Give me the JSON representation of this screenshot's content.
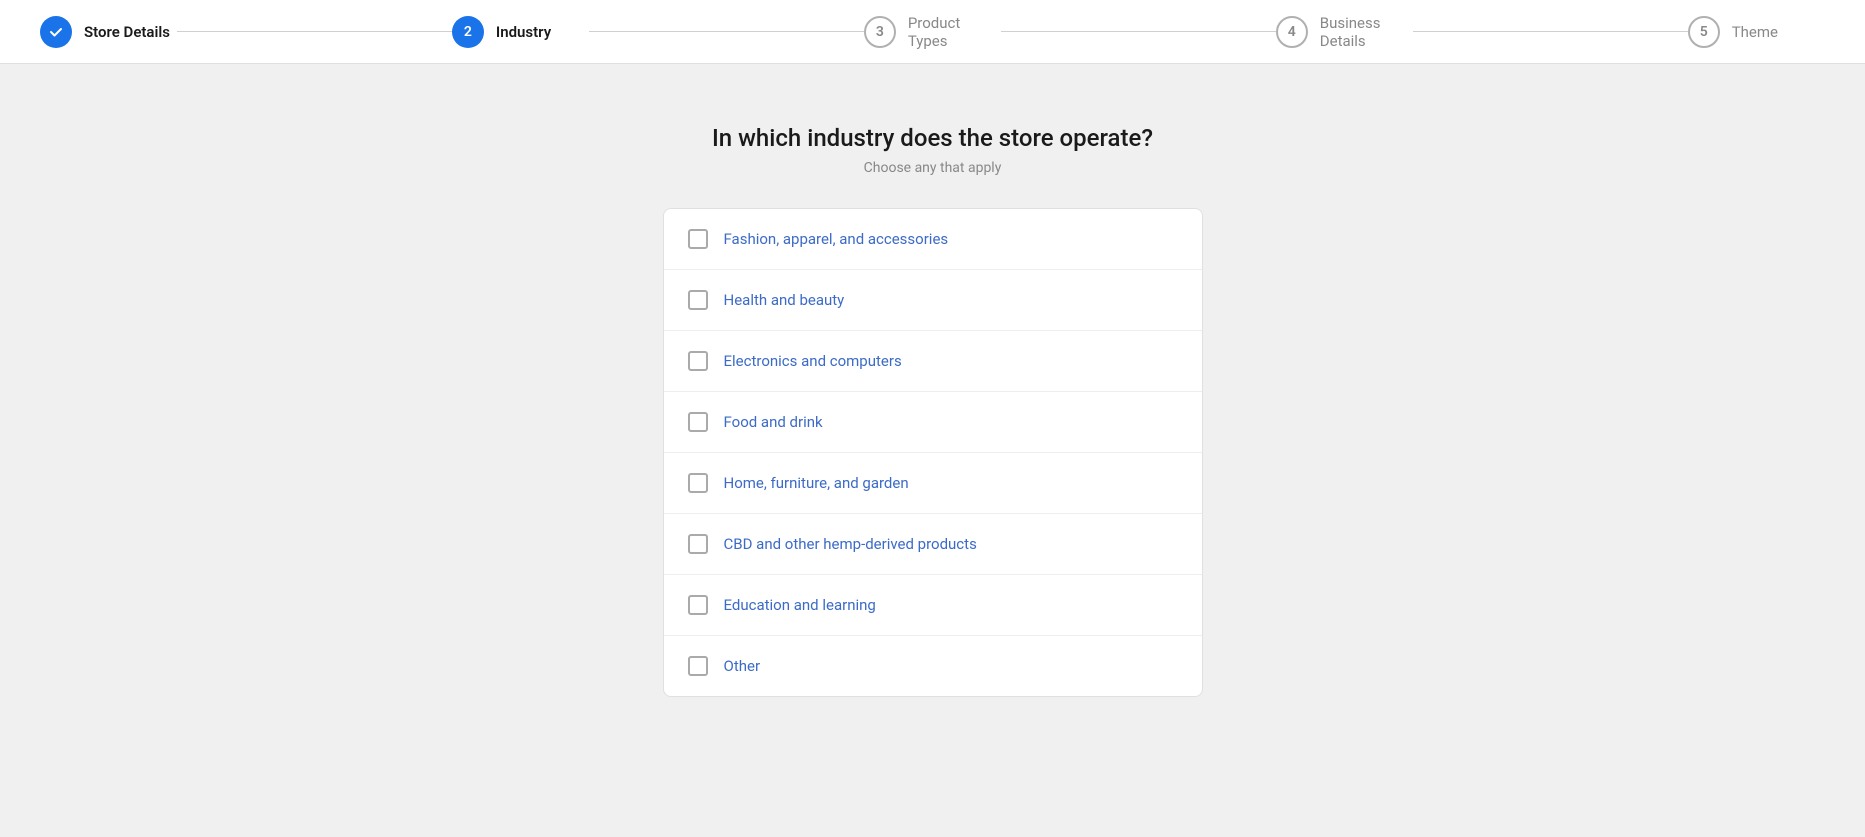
{
  "stepper": {
    "steps": [
      {
        "id": "store-details",
        "number": "✓",
        "label": "Store Details",
        "state": "completed"
      },
      {
        "id": "industry",
        "number": "2",
        "label": "Industry",
        "state": "active"
      },
      {
        "id": "product-types",
        "number": "3",
        "label": "Product Types",
        "state": "inactive"
      },
      {
        "id": "business-details",
        "number": "4",
        "label": "Business Details",
        "state": "inactive"
      },
      {
        "id": "theme",
        "number": "5",
        "label": "Theme",
        "state": "inactive"
      }
    ]
  },
  "page": {
    "title": "In which industry does the store operate?",
    "subtitle": "Choose any that apply"
  },
  "options": [
    {
      "id": "fashion",
      "label": "Fashion, apparel, and accessories"
    },
    {
      "id": "health-beauty",
      "label": "Health and beauty"
    },
    {
      "id": "electronics",
      "label": "Electronics and computers"
    },
    {
      "id": "food-drink",
      "label": "Food and drink"
    },
    {
      "id": "home-furniture",
      "label": "Home, furniture, and garden"
    },
    {
      "id": "cbd",
      "label": "CBD and other hemp-derived products"
    },
    {
      "id": "education",
      "label": "Education and learning"
    },
    {
      "id": "other",
      "label": "Other"
    }
  ],
  "colors": {
    "accent": "#1a73e8",
    "text_primary": "#1a1a1a",
    "text_secondary": "#888888",
    "link_color": "#3c6bc7",
    "border": "#e0e0e0"
  }
}
